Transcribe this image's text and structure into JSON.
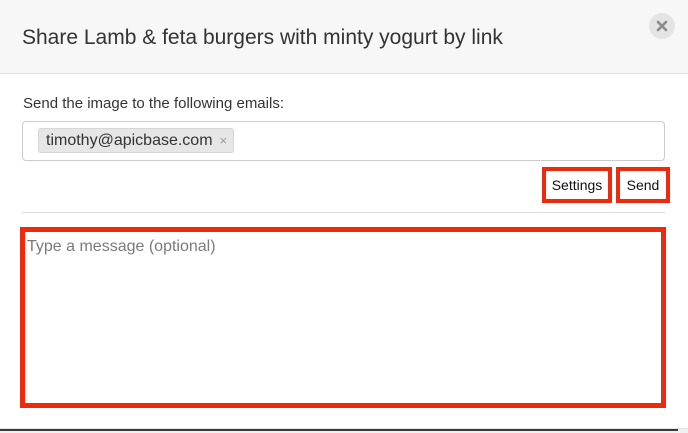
{
  "dialog": {
    "title": "Share Lamb & feta burgers with minty yogurt by link",
    "close_icon": "close-icon"
  },
  "email_section": {
    "label": "Send the image to the following emails:",
    "recipients": [
      {
        "email": "timothy@apicbase.com",
        "remove_symbol": "×"
      }
    ]
  },
  "actions": {
    "settings_label": "Settings",
    "send_label": "Send"
  },
  "message": {
    "placeholder": "Type a message (optional)",
    "value": ""
  },
  "colors": {
    "highlight": "#ee2a0e",
    "header_bg": "#f7f7f7",
    "tag_bg": "#e6e6e6",
    "close_bg": "#e4e4e4"
  }
}
